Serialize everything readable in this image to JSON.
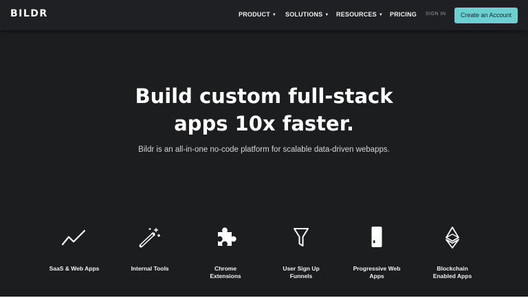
{
  "brand": {
    "logo_text": "BILDR"
  },
  "nav": {
    "items": [
      {
        "label": "PRODUCT",
        "has_dropdown": true
      },
      {
        "label": "SOLUTIONS",
        "has_dropdown": true
      },
      {
        "label": "RESOURCES",
        "has_dropdown": true
      },
      {
        "label": "PRICING",
        "has_dropdown": false
      }
    ],
    "signin_label": "SIGN IN",
    "cta_label": "Create an Account",
    "caret_glyph": "▼"
  },
  "hero": {
    "headline_line1": "Build custom full-stack",
    "headline_line2": "apps 10x faster.",
    "subheadline": "Bildr is an all-in-one no-code platform for scalable data-driven webapps."
  },
  "features": [
    {
      "icon": "line-chart-icon",
      "label": "SaaS & Web Apps"
    },
    {
      "icon": "magic-wand-icon",
      "label": "Internal Tools"
    },
    {
      "icon": "puzzle-piece-icon",
      "label": "Chrome\nExtensions"
    },
    {
      "icon": "funnel-icon",
      "label": "User Sign Up\nFunnels"
    },
    {
      "icon": "mobile-phone-icon",
      "label": "Progressive Web\nApps"
    },
    {
      "icon": "ethereum-icon",
      "label": "Blockchain\nEnabled Apps"
    }
  ],
  "colors": {
    "background": "#1c1d1f",
    "navbar": "#1f2023",
    "cta": "#6ccfd0",
    "text": "#ffffff"
  }
}
